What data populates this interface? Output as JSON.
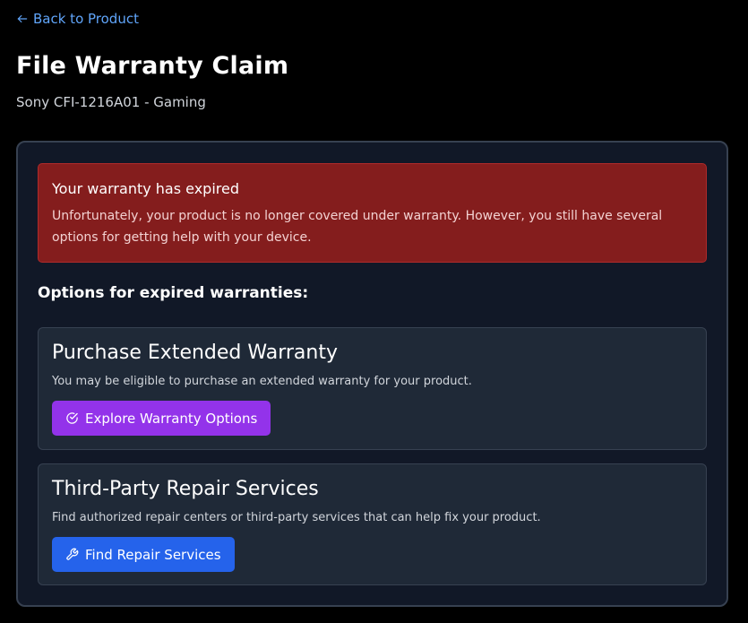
{
  "nav": {
    "back_label": "Back to Product",
    "back_icon": "arrow-left-icon"
  },
  "header": {
    "title": "File Warranty Claim",
    "product": "Sony CFI-1216A01 - Gaming"
  },
  "alert": {
    "title": "Your warranty has expired",
    "body": "Unfortunately, your product is no longer covered under warranty. However, you still have several options for getting help with your device."
  },
  "options": {
    "heading": "Options for expired warranties:",
    "items": [
      {
        "title": "Purchase Extended Warranty",
        "description": "You may be eligible to purchase an extended warranty for your product.",
        "button_label": "Explore Warranty Options",
        "button_icon": "check-circle-icon",
        "button_color": "#9333ea"
      },
      {
        "title": "Third-Party Repair Services",
        "description": "Find authorized repair centers or third-party services that can help fix your product.",
        "button_label": "Find Repair Services",
        "button_icon": "wrench-icon",
        "button_color": "#2563eb"
      }
    ]
  },
  "colors": {
    "background": "#000000",
    "panel": "#111827",
    "card": "#1f2937",
    "alert": "#841d1d",
    "link": "#60a5fa"
  }
}
